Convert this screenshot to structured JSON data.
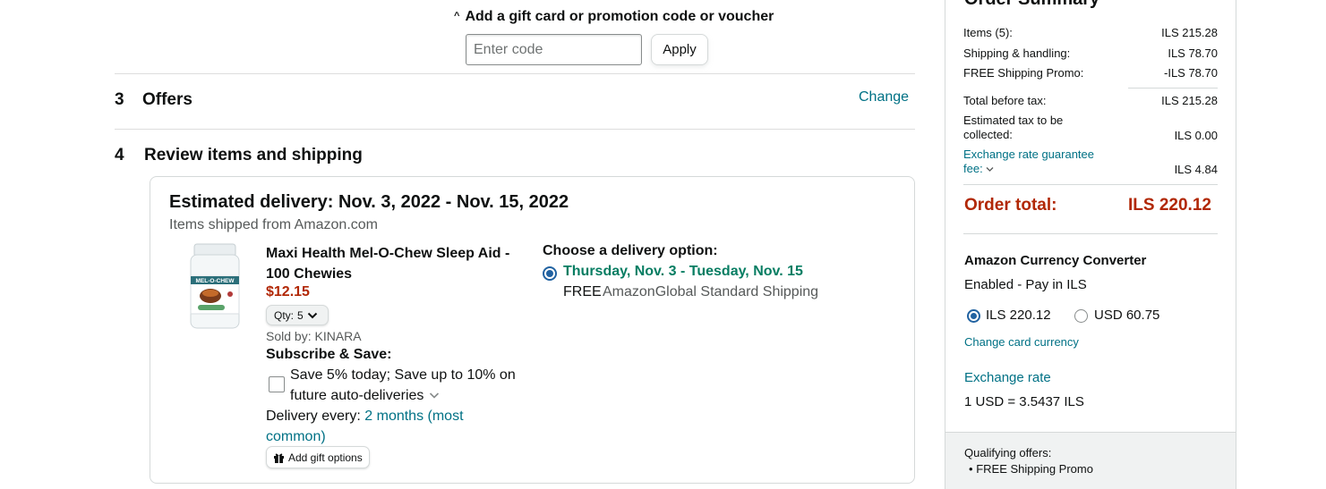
{
  "gift": {
    "toggle_label": "Add a gift card or promotion code or voucher",
    "chevron": "^",
    "code_placeholder": "Enter code",
    "code_value": "",
    "apply_label": "Apply"
  },
  "steps": {
    "offers": {
      "number": "3",
      "title": "Offers",
      "action": "Change"
    },
    "review": {
      "number": "4",
      "title": "Review items and shipping"
    }
  },
  "shipment": {
    "estimated_delivery": "Estimated delivery: Nov. 3, 2022 - Nov. 15, 2022",
    "shipped_from": "Items shipped from Amazon.com",
    "product": {
      "image_icon": "product-bottle-image",
      "image_brand_text": "MEL-O-CHEW",
      "title": "Maxi Health Mel-O-Chew Sleep Aid - 100 Chewies",
      "price": "$12.15",
      "qty_label": "Qty:",
      "qty_value": "5",
      "sold_by": "Sold by: KINARA"
    },
    "subscribe": {
      "title": "Subscribe & Save:",
      "checked": false,
      "text": "Save 5% today; Save up to 10% on future auto-deliveries",
      "delivery_every_label": "Delivery every:",
      "delivery_every_value": "2 months (most common)"
    },
    "gift_options_label": "Add gift options",
    "gift_icon": "gift-icon",
    "delivery": {
      "choose_label": "Choose a delivery option:",
      "selected": true,
      "date_range": "Thursday, Nov. 3 - Tuesday, Nov. 15",
      "price": "FREE",
      "method": "AmazonGlobal Standard Shipping"
    }
  },
  "summary": {
    "title": "Order Summary",
    "rows": [
      {
        "label": "Items (5):",
        "value": "ILS 215.28"
      },
      {
        "label": "Shipping & handling:",
        "value": "ILS 78.70"
      },
      {
        "label": "FREE Shipping Promo:",
        "value": "-ILS 78.70"
      },
      {
        "label": "Total before tax:",
        "value": "ILS 215.28"
      },
      {
        "label": "Estimated tax to be collected:",
        "value": "ILS 0.00"
      },
      {
        "label": "Exchange rate guarantee fee:",
        "value": "ILS 4.84"
      }
    ],
    "order_total_label": "Order total:",
    "order_total_value": "ILS 220.12",
    "converter": {
      "title": "Amazon Currency Converter",
      "status": "Enabled - Pay in ILS",
      "options": [
        {
          "label": "ILS 220.12",
          "selected": true
        },
        {
          "label": "USD 60.75",
          "selected": false
        }
      ],
      "change_currency": "Change card currency",
      "exchange_title": "Exchange rate",
      "exchange_value": "1 USD = 3.5437 ILS"
    },
    "qualifying": {
      "title": "Qualifying offers:",
      "items": [
        "FREE Shipping Promo"
      ]
    }
  },
  "colors": {
    "link": "#007185",
    "price_red": "#b12704",
    "delivery_green": "#067d62",
    "radio_blue": "#2162a1"
  }
}
